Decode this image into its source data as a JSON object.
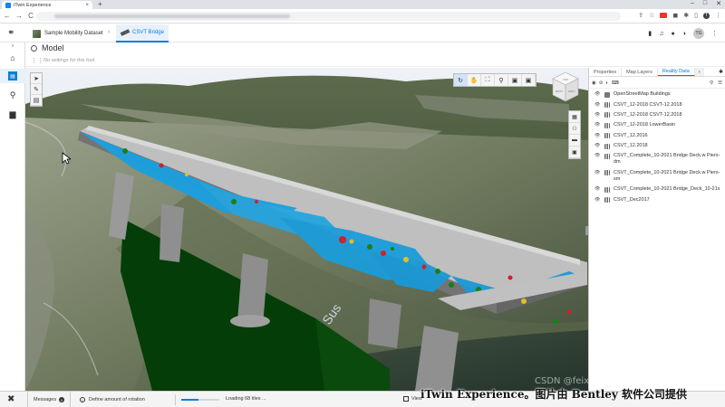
{
  "browser": {
    "tab_title": "iTwin Experience",
    "tab_close": "×",
    "new_tab": "+",
    "win_min": "–",
    "win_max": "□",
    "win_close": "✕",
    "back": "←",
    "forward": "→",
    "reload": "C"
  },
  "header": {
    "crumb1": "Sample Mobility Dataset",
    "crumb_sep": "›",
    "crumb2": "CSVT Bridge",
    "avatar": "TG"
  },
  "leftrail": {
    "expand": "›"
  },
  "model": {
    "title": "Model",
    "no_settings": "No settings for this tool."
  },
  "viewcube": {
    "top": "TOP",
    "front": "FRONT",
    "right": "RIGHT"
  },
  "viewport_label": "Sus",
  "panel": {
    "tabs": [
      "Properties",
      "Map Layers",
      "Reality Data"
    ],
    "active_tab": 2,
    "more": "›",
    "reality_data": [
      {
        "name": "OpenStreetMap Buildings"
      },
      {
        "name": "CSVT_12-2018 CSVT-12.2018"
      },
      {
        "name": "CSVT_12-2018 CSVT-12.2018"
      },
      {
        "name": "CSVT_12-2018 LowerBasin"
      },
      {
        "name": "CSVT_12.2016"
      },
      {
        "name": "CSVT_12.2018"
      },
      {
        "name": "CSVT_Complete_10-2021 Bridge Deck.w Piers-dm"
      },
      {
        "name": "CSVT_Complete_10-2021 Bridge Deck.w Piers-sm"
      },
      {
        "name": "CSVT_Complete_10-2021 Bridge_Deck_10-21s"
      },
      {
        "name": "CSVT_Dec2017"
      }
    ]
  },
  "statusbar": {
    "messages": "Messages",
    "messages_count": "0",
    "prompt": "Define amount of rotation",
    "loading_fraction": 0.45,
    "loading": "Loading 68 tiles ...",
    "view": "View"
  },
  "caption": "iTwin Experience。图片由 Bentley 软件公司提供",
  "watermark": "CSDN @feixiangzn"
}
